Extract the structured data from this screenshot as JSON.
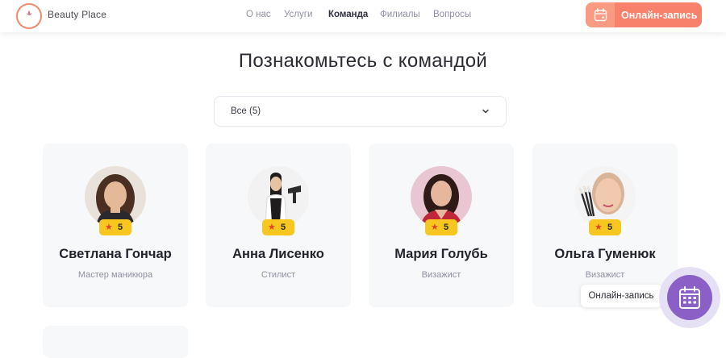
{
  "brand": {
    "name": "Beauty Place"
  },
  "nav": {
    "items": [
      {
        "label": "О нас"
      },
      {
        "label": "Услуги"
      },
      {
        "label": "Команда",
        "active": true
      },
      {
        "label": "Филиалы"
      },
      {
        "label": "Вопросы"
      }
    ]
  },
  "header": {
    "book_label": "Онлайн-запись",
    "book_icon": "calendar-icon"
  },
  "page": {
    "title": "Познакомьтесь с командой"
  },
  "filter": {
    "selected": "Все (5)",
    "icon": "chevron-down-icon"
  },
  "team": [
    {
      "name": "Светлана Гончар",
      "role": "Мастер маникюра",
      "rating": "5"
    },
    {
      "name": "Анна Лисенко",
      "role": "Стилист",
      "rating": "5"
    },
    {
      "name": "Мария Голубь",
      "role": "Визажист",
      "rating": "5"
    },
    {
      "name": "Ольга Гуменюк",
      "role": "Визажист",
      "rating": "5"
    }
  ],
  "floating": {
    "tooltip": "Онлайн-запись",
    "icon": "calendar-icon"
  },
  "colors": {
    "accent": "#f7816a",
    "rating_badge": "#f7c61f",
    "fab": "#8a5fc6",
    "card_bg": "#f7f8fa"
  }
}
